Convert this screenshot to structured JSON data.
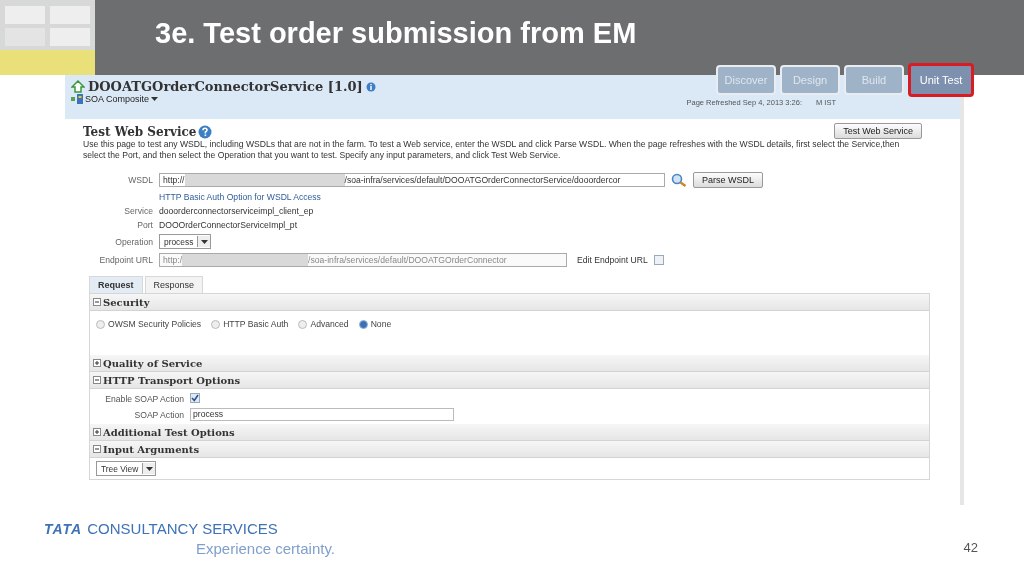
{
  "slide": {
    "title": "3e. Test order submission from EM",
    "page_number": "42",
    "brand_mark": "TATA",
    "brand_name": "CONSULTANCY SERVICES",
    "tagline": "Experience certainty."
  },
  "steps": [
    {
      "label": "Discover",
      "selected": false
    },
    {
      "label": "Design",
      "selected": false
    },
    {
      "label": "Build",
      "selected": false
    },
    {
      "label": "Unit Test",
      "selected": true
    }
  ],
  "screen": {
    "header": {
      "title": "DOOATGOrderConnectorService [1.0]",
      "menu": "SOA Composite",
      "refreshed": "Page Refreshed Sep 4, 2013 3:26:",
      "refreshed_tail": "M IST"
    },
    "heading": "Test Web Service",
    "description": "Use this page to test any WSDL, including WSDLs that are not in the farm. To test a Web service, enter the WSDL and click Parse WSDL. When the page refreshes with the WSDL details, first select the Service,then select the Port, and then select the Operation that you want to test. Specify any input parameters, and click Test Web Service.",
    "test_button": "Test Web Service",
    "wsdl": {
      "label": "WSDL",
      "value_start": "http://",
      "value_end": "/soa-infra/services/default/DOOATGOrderConnectorService/dooordercor",
      "button": "Parse WSDL",
      "link": "HTTP Basic Auth Option for WSDL Access"
    },
    "service": {
      "label": "Service",
      "value": "dooorderconnectorserviceimpl_client_ep"
    },
    "port": {
      "label": "Port",
      "value": "DOOOrderConnectorServiceImpl_pt"
    },
    "operation": {
      "label": "Operation",
      "value": "process"
    },
    "endpoint": {
      "label": "Endpoint URL",
      "value_start": "http:/",
      "value_end": "/soa-infra/services/default/DOOATGOrderConnector",
      "edit_label": "Edit Endpoint URL",
      "edit_checked": false
    },
    "tabs": [
      {
        "label": "Request",
        "selected": true
      },
      {
        "label": "Response",
        "selected": false
      }
    ],
    "sections": [
      {
        "title": "Security",
        "expanded": true,
        "kind": "radios",
        "options": [
          {
            "label": "OWSM Security Policies",
            "selected": false
          },
          {
            "label": "HTTP Basic Auth",
            "selected": false
          },
          {
            "label": "Advanced",
            "selected": false
          },
          {
            "label": "None",
            "selected": true
          }
        ]
      },
      {
        "title": "Quality of Service",
        "expanded": false
      },
      {
        "title": "HTTP Transport Options",
        "expanded": true,
        "kind": "transport",
        "enable_label": "Enable SOAP Action",
        "enable_checked": true,
        "action_label": "SOAP Action",
        "action_value": "process"
      },
      {
        "title": "Additional Test Options",
        "expanded": false
      },
      {
        "title": "Input Arguments",
        "expanded": true,
        "kind": "view",
        "view": "Tree View"
      }
    ]
  }
}
